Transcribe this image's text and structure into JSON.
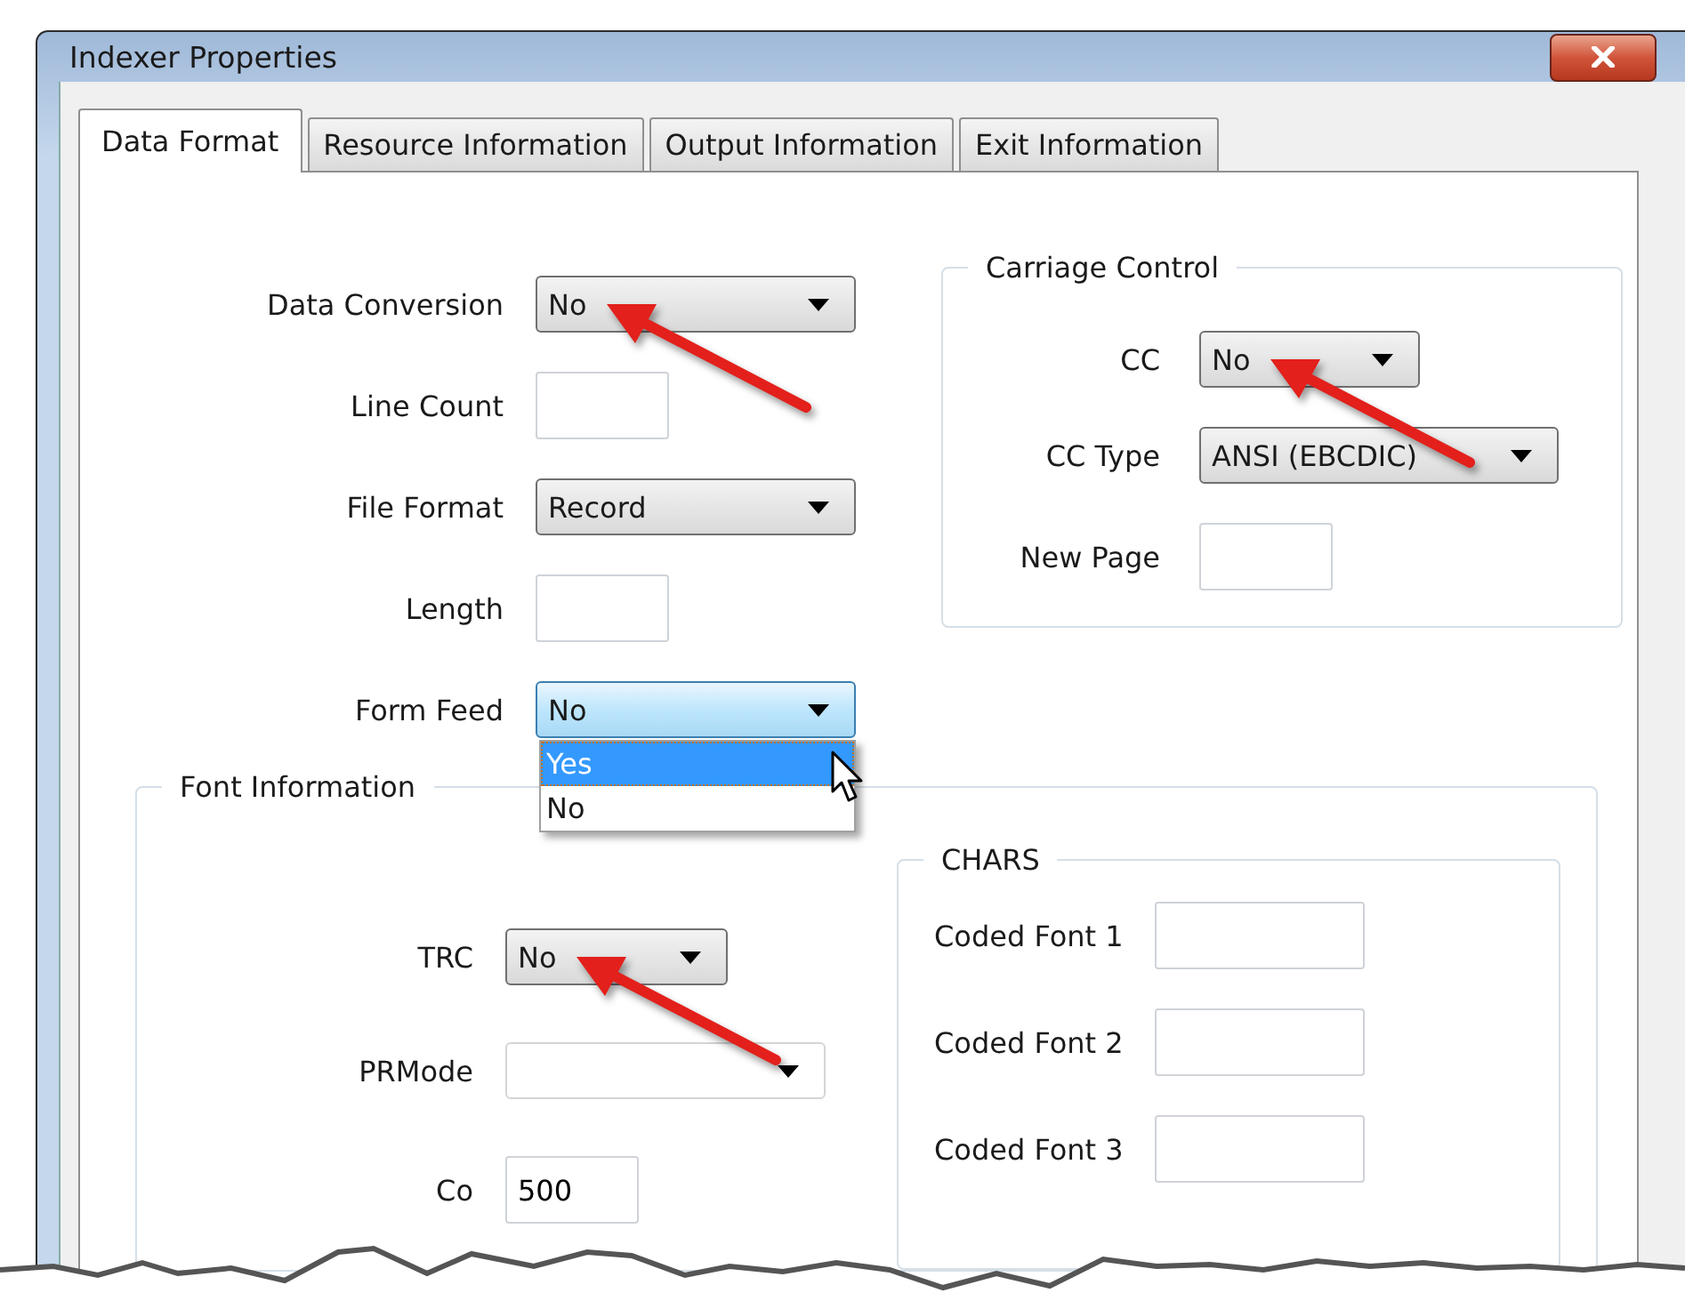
{
  "window": {
    "title": "Indexer Properties"
  },
  "tabs": [
    {
      "label": "Data Format",
      "selected": true
    },
    {
      "label": "Resource Information",
      "selected": false
    },
    {
      "label": "Output Information",
      "selected": false
    },
    {
      "label": "Exit Information",
      "selected": false
    }
  ],
  "fields": [
    {
      "kind": "combo",
      "label": "Data Conversion",
      "value": "No",
      "arrow": true
    },
    {
      "kind": "text",
      "label": "Line Count"
    },
    {
      "kind": "combo",
      "label": "File Format",
      "value": "Record"
    },
    {
      "kind": "text",
      "label": "Length"
    },
    {
      "kind": "combo",
      "label": "Form Feed",
      "value": "No",
      "focused": true,
      "options": [
        {
          "label": "Yes",
          "highlighted": true
        },
        {
          "label": "No",
          "highlighted": false
        }
      ]
    }
  ],
  "carriage_control": {
    "title": "Carriage Control",
    "fields": [
      {
        "kind": "combo",
        "label": "CC",
        "value": "No",
        "arrow": true
      },
      {
        "kind": "combo",
        "label": "CC Type",
        "value": "ANSI (EBCDIC)"
      },
      {
        "kind": "text",
        "label": "New Page"
      }
    ]
  },
  "font_information": {
    "title": "Font Information",
    "fields": [
      {
        "kind": "combo",
        "label": "TRC",
        "value": "No",
        "arrow": true
      },
      {
        "kind": "editcombo",
        "label": "PRMode"
      },
      {
        "kind": "text",
        "label": "Co",
        "value": "500"
      }
    ],
    "chars": {
      "title": "CHARS",
      "fields": [
        {
          "kind": "text",
          "label": "Coded Font 1"
        },
        {
          "kind": "text",
          "label": "Coded Font 2"
        },
        {
          "kind": "text",
          "label": "Coded Font 3"
        }
      ]
    }
  }
}
